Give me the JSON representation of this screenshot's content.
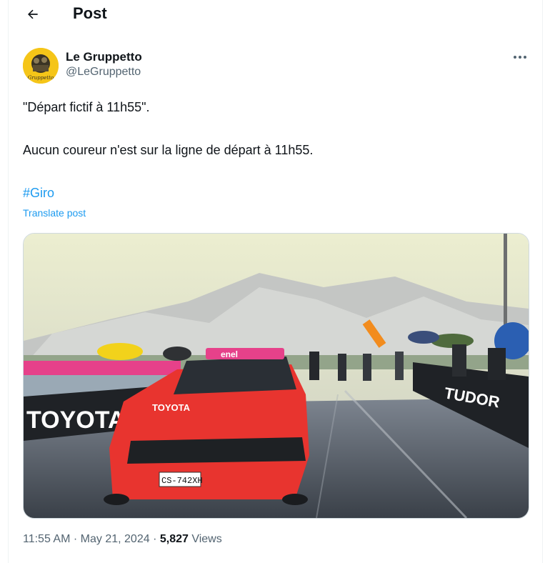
{
  "header": {
    "title": "Post"
  },
  "post": {
    "author_name": "Le Gruppetto",
    "author_handle": "@LeGruppetto",
    "line1": "\"Départ fictif à 11h55\".",
    "line2": "Aucun coureur n'est sur la ligne de départ à 11h55.",
    "hashtag": "#Giro",
    "translate_label": "Translate post",
    "media": {
      "banners": [
        "TUDOR",
        "TOYOTA"
      ],
      "car_brand": "TOYOTA",
      "car_sponsor": "enel",
      "plate": "CS-742XH"
    },
    "time": "11:55 AM",
    "date": "May 21, 2024",
    "views_count": "5,827",
    "views_label": "Views",
    "separator": "·"
  },
  "colors": {
    "accent": "#1d9bf0",
    "secondary_text": "#536471",
    "car": "#e8342f",
    "sponsor_pink": "#e6418a"
  },
  "icons": [
    "back-arrow-icon",
    "more-options-icon"
  ]
}
